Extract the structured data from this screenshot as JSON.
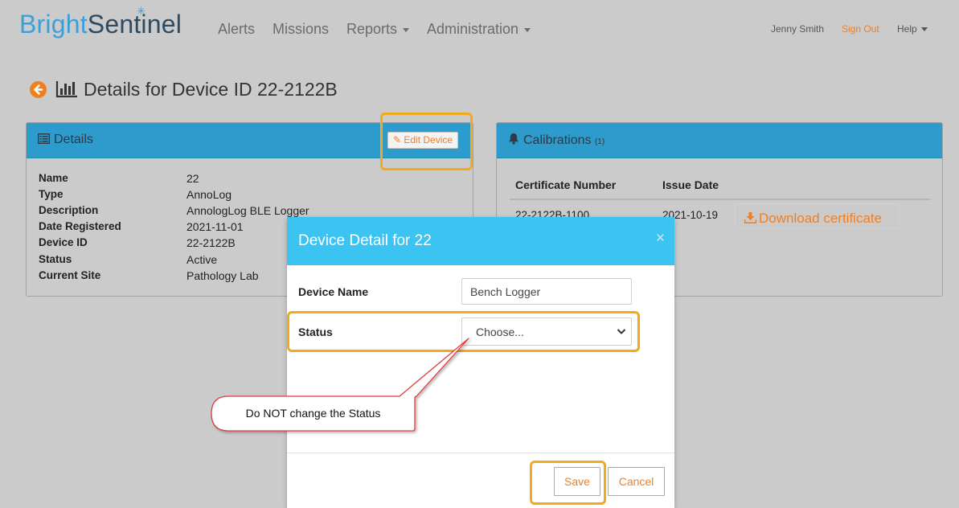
{
  "navbar": {
    "brand_part1": "Bright",
    "brand_part2": "Sentinel",
    "menu": [
      "Alerts",
      "Missions",
      "Reports",
      "Administration"
    ],
    "user": "Jenny Smith",
    "sign_out": "Sign Out",
    "help": "Help"
  },
  "page": {
    "title": "Details for Device ID 22-2122B"
  },
  "details": {
    "title": "Details",
    "edit_button": "Edit Device",
    "fields": [
      {
        "label": "Name",
        "value": "22"
      },
      {
        "label": "Type",
        "value": "AnnoLog"
      },
      {
        "label": "Description",
        "value": "AnnologLog BLE Logger"
      },
      {
        "label": "Date Registered",
        "value": "2021-11-01"
      },
      {
        "label": "Device ID",
        "value": "22-2122B"
      },
      {
        "label": "Status",
        "value": "Active"
      },
      {
        "label": "Current Site",
        "value": "Pathology Lab"
      }
    ]
  },
  "calibrations": {
    "title": "Calibrations",
    "count": "(1)",
    "columns": [
      "Certificate Number",
      "Issue Date"
    ],
    "rows": [
      {
        "certificate": "22-2122B-1100",
        "issue_date": "2021-10-19",
        "action": "Download certificate"
      }
    ]
  },
  "modal": {
    "title": "Device Detail for 22",
    "close": "×",
    "device_name_label": "Device Name",
    "device_name_value": "Bench Logger",
    "status_label": "Status",
    "status_value": "Choose...",
    "save": "Save",
    "cancel": "Cancel"
  },
  "annotation": {
    "callout": "Do NOT change the Status"
  },
  "colors": {
    "accent_orange": "#f07f22",
    "panel_blue": "#2d9bcc",
    "modal_blue": "#3bc3f2",
    "highlight": "#f2aa1b"
  }
}
